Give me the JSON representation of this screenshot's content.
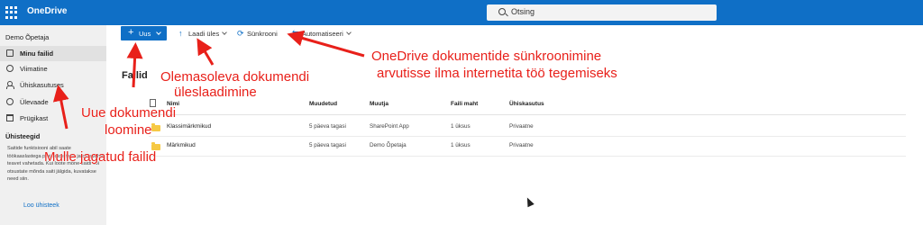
{
  "header": {
    "app_title": "OneDrive",
    "search_placeholder": "Otsing"
  },
  "sidebar": {
    "user": "Demo Õpetaja",
    "items": [
      {
        "label": "Minu failid",
        "icon": "folder-icon",
        "active": true
      },
      {
        "label": "Viimatine",
        "icon": "clock-icon"
      },
      {
        "label": "Ühiskasutuses",
        "icon": "people-icon"
      },
      {
        "label": "Ülevaade",
        "icon": "lightbulb-icon"
      },
      {
        "label": "Prügikast",
        "icon": "trash-icon"
      }
    ],
    "section_title": "Ühisteegid",
    "section_text": "Saitide funktsiooni abil saate töökaaslastega projektide teha ja omavahel teavet vahetada. Kui loote mõne saidi või otsustate mõnda saiti jälgida, kuvatakse need siin.",
    "create_link": "Loo ühisteek"
  },
  "toolbar": {
    "new_label": "Uus",
    "upload_label": "Laadi üles",
    "sync_label": "Sünkrooni",
    "automate_label": "Automatiseeri"
  },
  "main": {
    "title": "Failid",
    "columns": [
      "Nimi",
      "Muudetud",
      "Muutja",
      "Faili maht",
      "Ühiskasutus"
    ],
    "rows": [
      {
        "name": "Klassimärkmikud",
        "modified": "5 päeva tagasi",
        "modified_by": "SharePoint App",
        "size": "1 üksus",
        "sharing": "Privaatne"
      },
      {
        "name": "Märkmikud",
        "modified": "5 päeva tagasi",
        "modified_by": "Demo Õpetaja",
        "size": "1 üksus",
        "sharing": "Privaatne"
      }
    ]
  },
  "annotations": {
    "sync_line1": "OneDrive dokumentide sünkroonimine",
    "sync_line2": "arvutisse ilma internetita töö tegemiseks",
    "upload_line1": "Olemasoleva dokumendi",
    "upload_line2": "üleslaadimine",
    "new_line1": "Uue dokumendi",
    "new_line2": "loomine",
    "shared_label": "Mulle jagatud failid",
    "color": "#e8201a"
  },
  "colors": {
    "brand": "#0f6fc6",
    "sidebar_bg": "#f0f0f0",
    "folder": "#f6c944"
  }
}
